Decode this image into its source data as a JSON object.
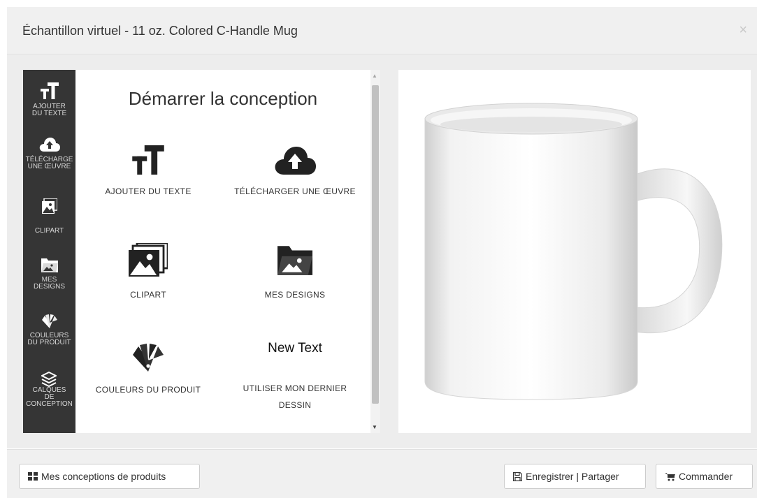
{
  "header": {
    "title": "Échantillon virtuel - 11 oz. Colored C-Handle Mug",
    "close": "×"
  },
  "sidebar": {
    "items": [
      {
        "label_lines": [
          "AJOUTER",
          "DU TEXTE"
        ],
        "icon": "text-icon"
      },
      {
        "label_lines": [
          "TÉLÉCHARGE",
          "UNE ŒUVRE"
        ],
        "icon": "cloud-upload-icon"
      },
      {
        "label_lines": [
          "CLIPART"
        ],
        "icon": "clipart-icon"
      },
      {
        "label_lines": [
          "MES",
          "DESIGNS"
        ],
        "icon": "folder-image-icon"
      },
      {
        "label_lines": [
          "COULEURS",
          "DU PRODUIT"
        ],
        "icon": "color-swatch-icon"
      },
      {
        "label_lines": [
          "CALQUES",
          "DE",
          "CONCEPTION"
        ],
        "icon": "layers-icon"
      }
    ]
  },
  "panel": {
    "title": "Démarrer la conception",
    "options": [
      {
        "label": "AJOUTER DU TEXTE",
        "icon": "text-icon"
      },
      {
        "label": "TÉLÉCHARGER UNE ŒUVRE",
        "icon": "cloud-upload-icon"
      },
      {
        "label": "CLIPART",
        "icon": "clipart-icon"
      },
      {
        "label": "MES DESIGNS",
        "icon": "folder-image-icon"
      },
      {
        "label": "COULEURS DU PRODUIT",
        "icon": "color-swatch-icon"
      },
      {
        "label_lines": [
          "UTILISER MON DERNIER",
          "DESSIN"
        ],
        "preview_text": "New Text"
      }
    ]
  },
  "footer": {
    "designs_button": "Mes conceptions de produits",
    "save_button": "Enregistrer | Partager",
    "order_button": "Commander"
  },
  "colors": {
    "sidebar_bg": "#353535",
    "panel_bg": "#ffffff",
    "body_bg": "#ededed",
    "header_bg": "#f0f0f0"
  }
}
